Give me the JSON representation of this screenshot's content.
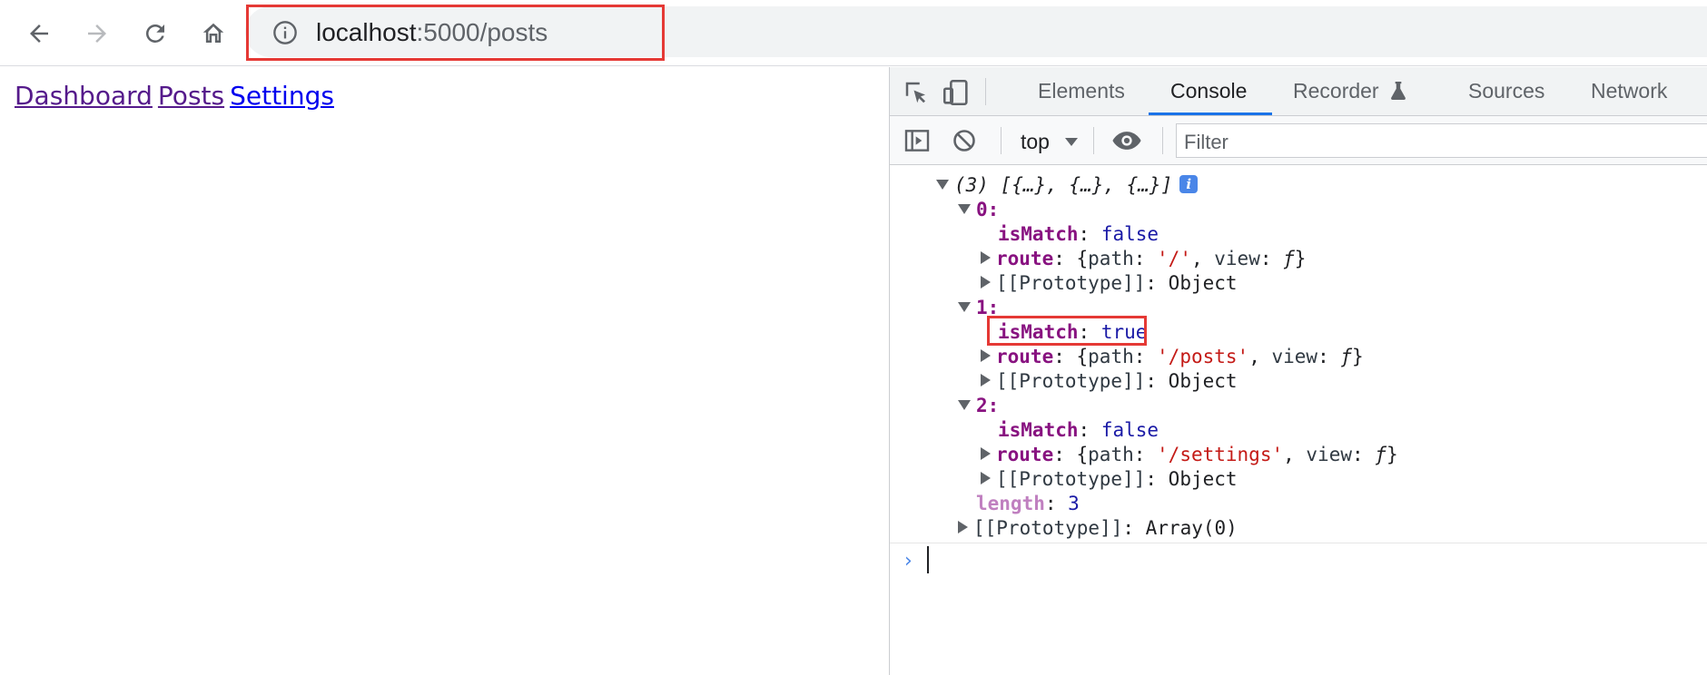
{
  "browser": {
    "url_host": "localhost",
    "url_rest": ":5000/posts"
  },
  "page": {
    "links": [
      {
        "label": "Dashboard",
        "state": "visited"
      },
      {
        "label": "Posts",
        "state": "visited"
      },
      {
        "label": "Settings",
        "state": "unvisited"
      }
    ],
    "colors": {
      "visited": "#551a8b",
      "unvisited": "#0000ee"
    }
  },
  "devtools": {
    "tabs": [
      "Elements",
      "Console",
      "Recorder",
      "Sources",
      "Network"
    ],
    "active_tab": "Console",
    "context": "top",
    "filter_placeholder": "Filter",
    "console": {
      "summary": "(3) [{…}, {…}, {…}]",
      "items": [
        {
          "index": "0",
          "isMatch": "false",
          "path": "'/'"
        },
        {
          "index": "1",
          "isMatch": "true",
          "path": "'/posts'"
        },
        {
          "index": "2",
          "isMatch": "false",
          "path": "'/settings'"
        }
      ],
      "labels": {
        "isMatch": "isMatch",
        "route": "route",
        "path": "path",
        "view": "view",
        "f": "ƒ",
        "proto": "[[Prototype]]",
        "object": "Object",
        "length": "length",
        "array_proto": "Array(0)"
      },
      "length_value": "3",
      "info_badge": "i"
    }
  },
  "highlight_color": "#e53935"
}
